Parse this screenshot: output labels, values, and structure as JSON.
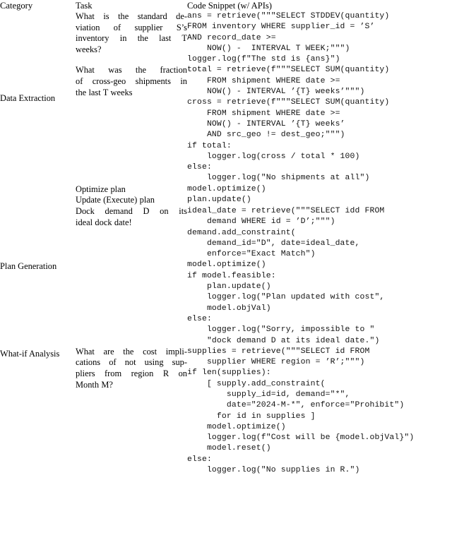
{
  "table": {
    "columns": [
      {
        "key": "category",
        "label": "Category"
      },
      {
        "key": "task",
        "label": "Task"
      },
      {
        "key": "code",
        "label": "Code Snippet (w/ APIs)"
      }
    ],
    "sections": [
      {
        "category": "Data Extraction",
        "rows": [
          {
            "task": "What is the standard de-viation of supplier S’s inventory in the last T weeks?",
            "task_lines": [
              "What is the standard de-",
              "viation of supplier S’s",
              "inventory in the last T",
              "weeks?"
            ],
            "code": "ans = retrieve(\"\"\"SELECT STDDEV(quantity)\nFROM inventory WHERE supplier_id = ’S’\nAND record_date >=\n    NOW() -  INTERVAL T WEEK;\"\"\")\nlogger.log(f\"The std is {ans}\")"
          },
          {
            "task": "What was the fraction of cross-geo shipments in the last T weeks",
            "task_lines": [
              "What was the fraction",
              "of cross-geo shipments in",
              "the last T weeks"
            ],
            "code": "total = retrieve(f\"\"\"SELECT SUM(quantity)\n    FROM shipment WHERE date >=\n    NOW() - INTERVAL ’{T} weeks’\"\"\")\ncross = retrieve(f\"\"\"SELECT SUM(quantity)\n    FROM shipment WHERE date >=\n    NOW() - INTERVAL ’{T} weeks’\n    AND src_geo != dest_geo;\"\"\")\nif total:\n    logger.log(cross / total * 100)\nelse:\n    logger.log(\"No shipments at all\")"
          }
        ]
      },
      {
        "category": "Plan Generation",
        "rows": [
          {
            "task": "Optimize plan",
            "task_lines": [
              "Optimize plan"
            ],
            "code": "model.optimize()"
          },
          {
            "task": "Update (Execute) plan",
            "task_lines": [
              "Update (Execute) plan"
            ],
            "code": "plan.update()"
          },
          {
            "task": "Dock demand D on its ideal dock date!",
            "task_lines": [
              "Dock demand D on its",
              "ideal dock date!"
            ],
            "code": "ideal_date = retrieve(\"\"\"SELECT idd FROM\n    demand WHERE id = ’D’;\"\"\")\ndemand.add_constraint(\n    demand_id=\"D\", date=ideal_date,\n    enforce=\"Exact Match\")\nmodel.optimize()\nif model.feasible:\n    plan.update()\n    logger.log(\"Plan updated with cost\",\n    model.objVal)\nelse:\n    logger.log(\"Sorry, impossible to \"\n    \"dock demand D at its ideal date.\")"
          }
        ]
      },
      {
        "category": "What-if Analysis",
        "rows": [
          {
            "task": "What are the cost impli-cations of not using sup-pliers from region R on Month M?",
            "task_lines": [
              "What are the cost impli-",
              "cations of not using sup-",
              "pliers from region R on",
              "Month M?"
            ],
            "code": "supplies = retrieve(\"\"\"SELECT id FROM\n    supplier WHERE region = ’R’;\"\"\")\nif len(supplies):\n    [ supply.add_constraint(\n        supply_id=id, demand=\"*\",\n        date=\"2024-M-*\", enforce=\"Prohibit\")\n      for id in supplies ]\n    model.optimize()\n    logger.log(f\"Cost will be {model.objVal}\")\n    model.reset()\nelse:\n    logger.log(\"No supplies in R.\")"
          }
        ]
      }
    ]
  }
}
